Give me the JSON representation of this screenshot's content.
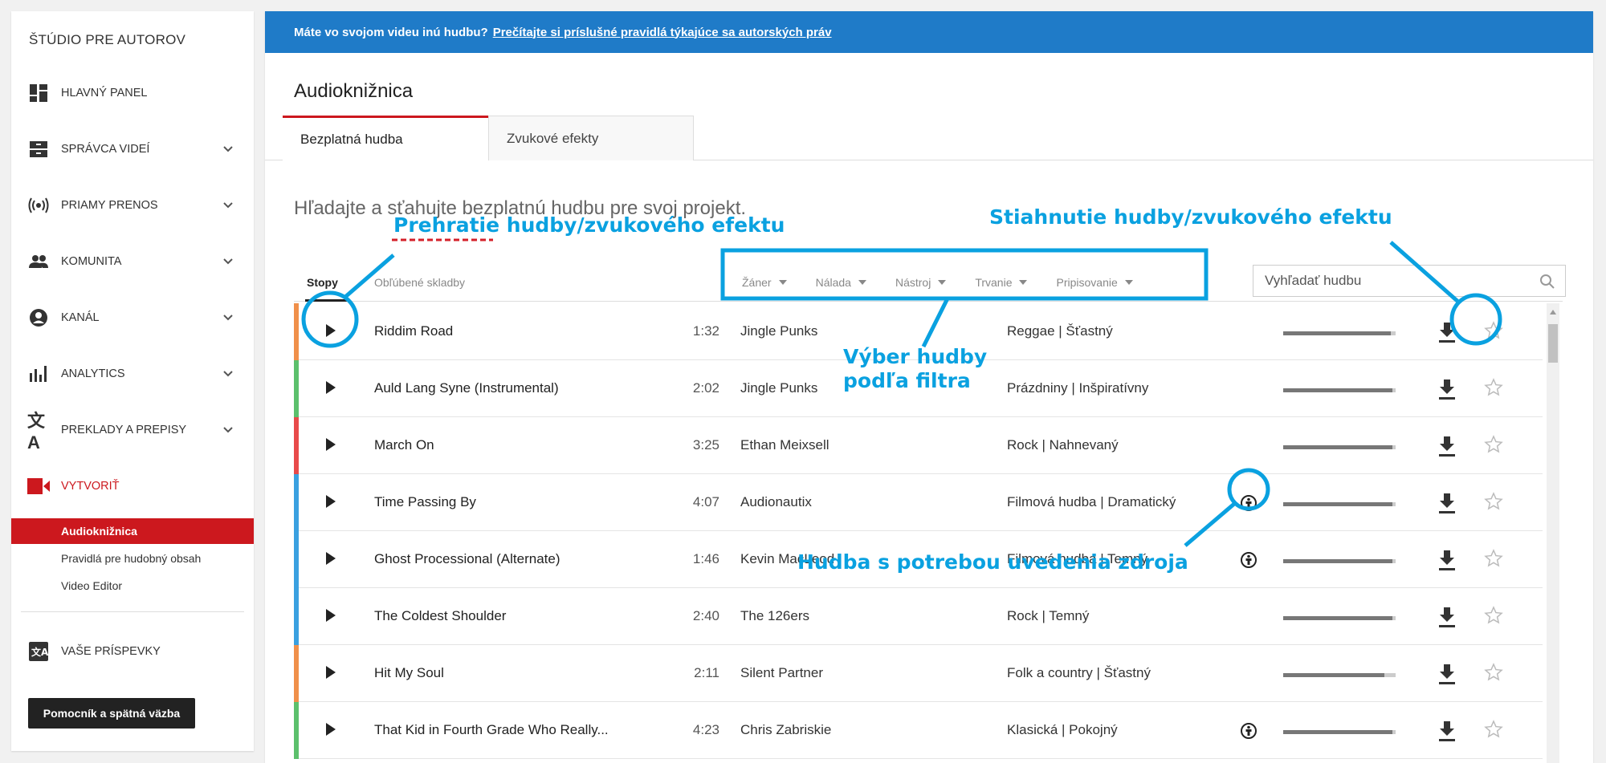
{
  "sidebar": {
    "title": "ŠTÚDIO PRE AUTOROV",
    "items": [
      {
        "label": "HLAVNÝ PANEL",
        "icon": "dashboard-icon"
      },
      {
        "label": "SPRÁVCA VIDEÍ",
        "icon": "video-manager-icon"
      },
      {
        "label": "PRIAMY PRENOS",
        "icon": "live-stream-icon"
      },
      {
        "label": "KOMUNITA",
        "icon": "community-icon"
      },
      {
        "label": "KANÁL",
        "icon": "channel-icon"
      },
      {
        "label": "ANALYTICS",
        "icon": "analytics-icon"
      },
      {
        "label": "PREKLADY A PREPISY",
        "icon": "translate-icon"
      },
      {
        "label": "VYTVORIŤ",
        "icon": "create-icon"
      }
    ],
    "sub_items": [
      {
        "label": "Audioknižnica",
        "active": true
      },
      {
        "label": "Pravidlá pre hudobný obsah"
      },
      {
        "label": "Video Editor"
      }
    ],
    "contrib_label": "VAŠE PRÍSPEVKY",
    "help_label": "Pomocník a spätná väzba"
  },
  "banner": {
    "text": "Máte vo svojom videu inú hudbu?",
    "link": "Prečítajte si príslušné pravidlá týkajúce sa autorských práv",
    "color": "#1f7bc8"
  },
  "page": {
    "title": "Audioknižnica",
    "tabs": [
      {
        "label": "Bezplatná hudba"
      },
      {
        "label": "Zvukové efekty"
      }
    ],
    "subtitle": "Hľadajte a sťahujte bezplatnú hudbu pre svoj projekt."
  },
  "filter": {
    "tab_tracks": "Stopy",
    "tab_favorites": "Obľúbené skladby",
    "filters": [
      "Žáner",
      "Nálada",
      "Nástroj",
      "Trvanie",
      "Pripisovanie"
    ],
    "search_placeholder": "Vyhľadať hudbu"
  },
  "tracks": [
    {
      "title": "Riddim Road",
      "duration": "1:32",
      "artist": "Jingle Punks",
      "genre": "Reggae | Šťastný",
      "attribution": false,
      "color": "#f0904a",
      "progress": 0.96
    },
    {
      "title": "Auld Lang Syne (Instrumental)",
      "duration": "2:02",
      "artist": "Jingle Punks",
      "genre": "Prázdniny | Inšpiratívny",
      "attribution": false,
      "color": "#5cc06c",
      "progress": 0.97
    },
    {
      "title": "March On",
      "duration": "3:25",
      "artist": "Ethan Meixsell",
      "genre": "Rock | Nahnevaný",
      "attribution": false,
      "color": "#e84a4a",
      "progress": 0.97
    },
    {
      "title": "Time Passing By",
      "duration": "4:07",
      "artist": "Audionautix",
      "genre": "Filmová hudba | Dramatický",
      "attribution": true,
      "color": "#3aa0e0",
      "progress": 0.97
    },
    {
      "title": "Ghost Processional (Alternate)",
      "duration": "1:46",
      "artist": "Kevin MacLeod",
      "genre": "Filmová hudba | Temný",
      "attribution": true,
      "color": "#3aa0e0",
      "progress": 0.97
    },
    {
      "title": "The Coldest Shoulder",
      "duration": "2:40",
      "artist": "The 126ers",
      "genre": "Rock | Temný",
      "attribution": false,
      "color": "#3aa0e0",
      "progress": 0.97
    },
    {
      "title": "Hit My Soul",
      "duration": "2:11",
      "artist": "Silent Partner",
      "genre": "Folk a country | Šťastný",
      "attribution": false,
      "color": "#f0904a",
      "progress": 0.9
    },
    {
      "title": "That Kid in Fourth Grade Who Really...",
      "duration": "4:23",
      "artist": "Chris Zabriskie",
      "genre": "Klasická | Pokojný",
      "attribution": true,
      "color": "#5cc06c",
      "progress": 0.97
    }
  ],
  "annotations": {
    "play": "Prehratie hudby/zvukového efektu",
    "download": "Stiahnutie hudby/zvukového efektu",
    "filter_line1": "Výber hudby",
    "filter_line2": "podľa filtra",
    "attribution": "Hudba s potrebou uvedenia zdroja",
    "color": "#0aa1e0"
  }
}
